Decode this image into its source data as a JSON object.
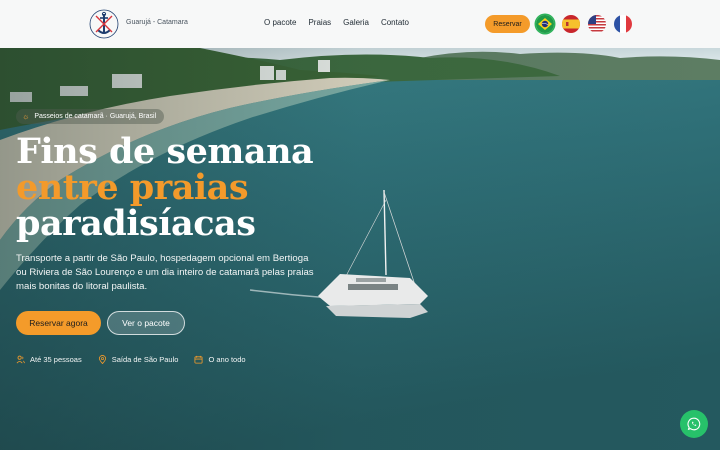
{
  "header": {
    "brand_text": "Guarujá - Catamara",
    "nav": [
      {
        "label": "O pacote"
      },
      {
        "label": "Praias"
      },
      {
        "label": "Galeria"
      },
      {
        "label": "Contato"
      }
    ],
    "reserve_label": "Reservar",
    "languages": [
      {
        "name": "brazil-flag-icon",
        "active": true
      },
      {
        "name": "spain-flag-icon",
        "active": false
      },
      {
        "name": "usa-flag-icon",
        "active": false
      },
      {
        "name": "france-flag-icon",
        "active": false
      }
    ]
  },
  "hero": {
    "tag": "Passeios de catamarã · Guarujá, Brasil",
    "title_line1": "Fins de semana",
    "title_line2": "entre praias",
    "title_line3": "paradisíacas",
    "description": "Transporte a partir de São Paulo, hospedagem opcional em Bertioga ou Riviera de São Lourenço e um dia inteiro de catamarã pelas praias mais bonitas do litoral paulista.",
    "primary_cta": "Reservar agora",
    "secondary_cta": "Ver o pacote",
    "facts": [
      {
        "icon": "people-icon",
        "text": "Até 35 pessoas"
      },
      {
        "icon": "location-pin-icon",
        "text": "Saída de São Paulo"
      },
      {
        "icon": "calendar-icon",
        "text": "O ano todo"
      }
    ]
  },
  "colors": {
    "accent": "#f49b2a",
    "whatsapp": "#27c16a",
    "header_bg": "#f7f8f8"
  },
  "floating": {
    "icon": "whatsapp-icon"
  }
}
